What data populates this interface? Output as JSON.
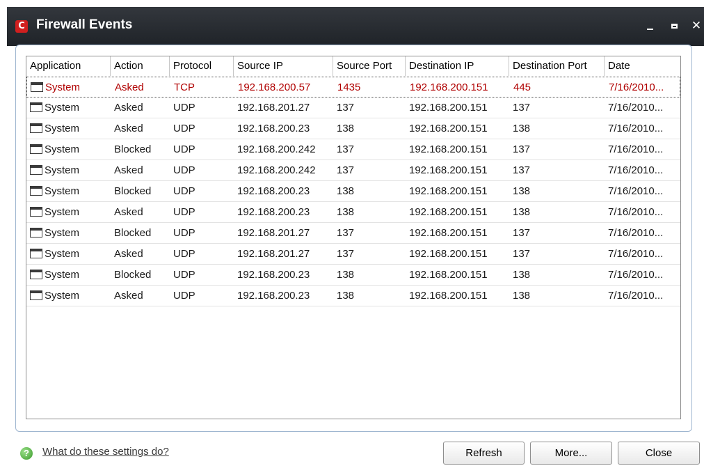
{
  "window": {
    "title": "Firewall Events",
    "logo_letter": "C",
    "controls": {
      "minimize": "",
      "maximize": "",
      "close": "✕"
    }
  },
  "table": {
    "columns": [
      "Application",
      "Action",
      "Protocol",
      "Source IP",
      "Source Port",
      "Destination IP",
      "Destination Port",
      "Date"
    ],
    "rows": [
      {
        "app": "System",
        "action": "Asked",
        "protocol": "TCP",
        "src_ip": "192.168.200.57",
        "src_port": "1435",
        "dst_ip": "192.168.200.151",
        "dst_port": "445",
        "date": "7/16/2010..."
      },
      {
        "app": "System",
        "action": "Asked",
        "protocol": "UDP",
        "src_ip": "192.168.201.27",
        "src_port": "137",
        "dst_ip": "192.168.200.151",
        "dst_port": "137",
        "date": "7/16/2010..."
      },
      {
        "app": "System",
        "action": "Asked",
        "protocol": "UDP",
        "src_ip": "192.168.200.23",
        "src_port": "138",
        "dst_ip": "192.168.200.151",
        "dst_port": "138",
        "date": "7/16/2010..."
      },
      {
        "app": "System",
        "action": "Blocked",
        "protocol": "UDP",
        "src_ip": "192.168.200.242",
        "src_port": "137",
        "dst_ip": "192.168.200.151",
        "dst_port": "137",
        "date": "7/16/2010..."
      },
      {
        "app": "System",
        "action": "Asked",
        "protocol": "UDP",
        "src_ip": "192.168.200.242",
        "src_port": "137",
        "dst_ip": "192.168.200.151",
        "dst_port": "137",
        "date": "7/16/2010..."
      },
      {
        "app": "System",
        "action": "Blocked",
        "protocol": "UDP",
        "src_ip": "192.168.200.23",
        "src_port": "138",
        "dst_ip": "192.168.200.151",
        "dst_port": "138",
        "date": "7/16/2010..."
      },
      {
        "app": "System",
        "action": "Asked",
        "protocol": "UDP",
        "src_ip": "192.168.200.23",
        "src_port": "138",
        "dst_ip": "192.168.200.151",
        "dst_port": "138",
        "date": "7/16/2010..."
      },
      {
        "app": "System",
        "action": "Blocked",
        "protocol": "UDP",
        "src_ip": "192.168.201.27",
        "src_port": "137",
        "dst_ip": "192.168.200.151",
        "dst_port": "137",
        "date": "7/16/2010..."
      },
      {
        "app": "System",
        "action": "Asked",
        "protocol": "UDP",
        "src_ip": "192.168.201.27",
        "src_port": "137",
        "dst_ip": "192.168.200.151",
        "dst_port": "137",
        "date": "7/16/2010..."
      },
      {
        "app": "System",
        "action": "Blocked",
        "protocol": "UDP",
        "src_ip": "192.168.200.23",
        "src_port": "138",
        "dst_ip": "192.168.200.151",
        "dst_port": "138",
        "date": "7/16/2010..."
      },
      {
        "app": "System",
        "action": "Asked",
        "protocol": "UDP",
        "src_ip": "192.168.200.23",
        "src_port": "138",
        "dst_ip": "192.168.200.151",
        "dst_port": "138",
        "date": "7/16/2010..."
      }
    ],
    "selected_row": 0,
    "row_icon": "application-window-icon"
  },
  "footer": {
    "help_icon": "help-icon",
    "help_link": "What do these settings do?",
    "buttons": {
      "refresh": "Refresh",
      "more": "More...",
      "close": "Close"
    }
  },
  "colors": {
    "titlebar": "#2a2e33",
    "selected_text": "#b00000",
    "panel_border": "#9fb6d0",
    "logo": "#d01f1f"
  }
}
